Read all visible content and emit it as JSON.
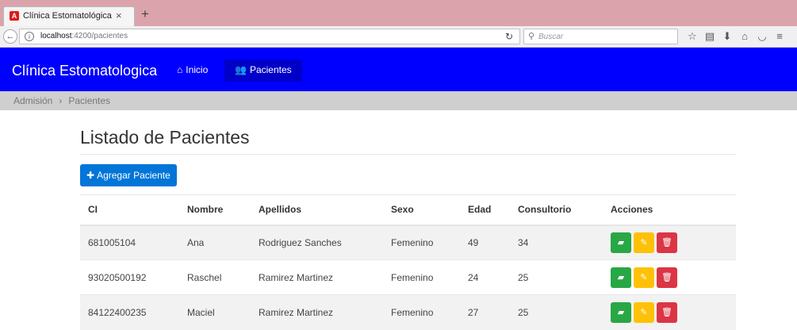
{
  "browser": {
    "tab_title": "Clínica Estomatológica",
    "tab_close": "×",
    "new_tab": "+",
    "url_host": "localhost",
    "url_path": ":4200/pacientes",
    "search_placeholder": "Buscar"
  },
  "app": {
    "brand": "Clínica Estomatologica",
    "nav": [
      {
        "label": "Inicio",
        "icon": "home-icon"
      },
      {
        "label": "Pacientes",
        "icon": "users-icon"
      }
    ],
    "active_nav": "Pacientes",
    "accent": "#0000ff"
  },
  "breadcrumb": [
    "Admisión",
    "Pacientes"
  ],
  "page": {
    "title": "Listado de Pacientes",
    "add_button": "Agregar Paciente"
  },
  "table": {
    "headers": [
      "CI",
      "Nombre",
      "Apellidos",
      "Sexo",
      "Edad",
      "Consultorio",
      "Acciones"
    ],
    "rows": [
      {
        "ci": "681005104",
        "nombre": "Ana",
        "apellidos": "Rodriguez Sanches",
        "sexo": "Femenino",
        "edad": "49",
        "consultorio": "34"
      },
      {
        "ci": "93020500192",
        "nombre": "Raschel",
        "apellidos": "Ramirez Martinez",
        "sexo": "Femenino",
        "edad": "24",
        "consultorio": "25"
      },
      {
        "ci": "84122400235",
        "nombre": "Maciel",
        "apellidos": "Ramirez Martinez",
        "sexo": "Femenino",
        "edad": "27",
        "consultorio": "25"
      }
    ],
    "action_colors": {
      "view": "#28a745",
      "edit": "#ffc107",
      "delete": "#dc3545"
    }
  }
}
